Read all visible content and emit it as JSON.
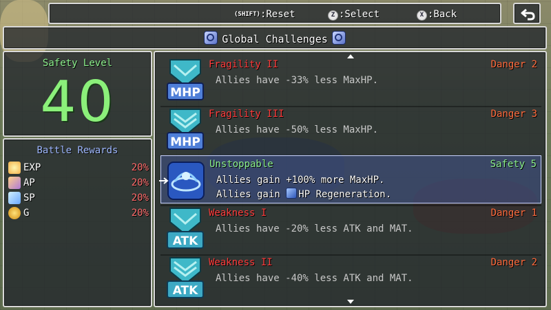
{
  "help": {
    "reset_key": "(SHIFT)",
    "reset_label": ":Reset",
    "select_key": "Z",
    "select_label": ":Select",
    "back_key": "X",
    "back_label": ":Back"
  },
  "header": {
    "title": "Global Challenges"
  },
  "safety": {
    "title": "Safety Level",
    "value": "40"
  },
  "rewards": {
    "title": "Battle Rewards",
    "items": [
      {
        "label": "EXP",
        "value": "20%",
        "icon": "star-icon",
        "color": "#f2b04a"
      },
      {
        "label": "AP",
        "value": "20%",
        "icon": "ap-icon",
        "color": "#b07ad8"
      },
      {
        "label": "SP",
        "value": "20%",
        "icon": "sp-icon",
        "color": "#6aa8ff"
      },
      {
        "label": "G",
        "value": "20%",
        "icon": "coin-icon",
        "color": "#f0b020"
      }
    ]
  },
  "challenges": [
    {
      "name": "Fragility II",
      "level": "Danger 2",
      "desc1": "Allies have -33% less MaxHP.",
      "icon_text": "MHP"
    },
    {
      "name": "Fragility III",
      "level": "Danger 3",
      "desc1": "Allies have -50% less MaxHP.",
      "icon_text": "MHP"
    },
    {
      "name": "Unstoppable",
      "level": "Safety 5",
      "desc1": "Allies gain +100% more MaxHP.",
      "desc2_pre": "Allies gain ",
      "desc2_post": "HP Regeneration."
    },
    {
      "name": "Weakness I",
      "level": "Danger 1",
      "desc1": "Allies have -20% less ATK and MAT.",
      "icon_text": "ATK"
    },
    {
      "name": "Weakness II",
      "level": "Danger 2",
      "desc1": "Allies have -40% less ATK and MAT.",
      "icon_text": "ATK"
    }
  ]
}
